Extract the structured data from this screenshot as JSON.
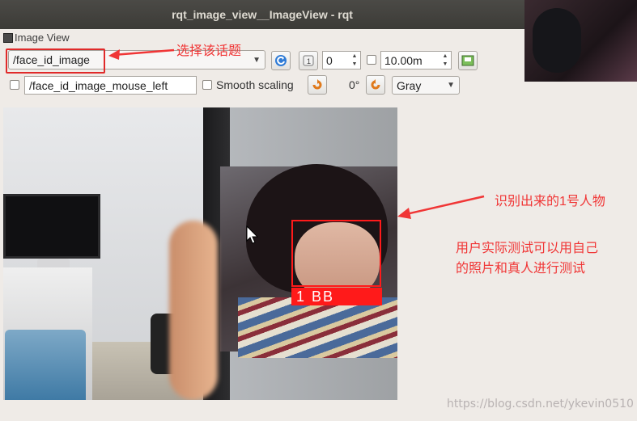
{
  "window": {
    "title": "rqt_image_view__ImageView - rqt"
  },
  "panel": {
    "label": "Image View"
  },
  "toolbar": {
    "topic_value": "/face_id_image",
    "spin_value": "0",
    "rate_value": "10.00m",
    "mouse_topic_value": "/face_id_image_mouse_left",
    "smooth_scaling_label": "Smooth scaling",
    "rotation_label": "0°",
    "color_scheme_value": "Gray"
  },
  "annotations": {
    "select_topic": "选择该话题",
    "detected_person": "识别出来的1号人物",
    "test_hint_line1": "用户实际测试可以用自己",
    "test_hint_line2": "的照片和真人进行测试"
  },
  "image": {
    "face_label": "1  BB"
  },
  "watermark": "https://blog.csdn.net/ykevin0510",
  "colors": {
    "annotation_red": "#f03636",
    "face_box_red": "#ff1a1a",
    "window_bg": "#efebe7",
    "titlebar": "#3c3b37"
  }
}
